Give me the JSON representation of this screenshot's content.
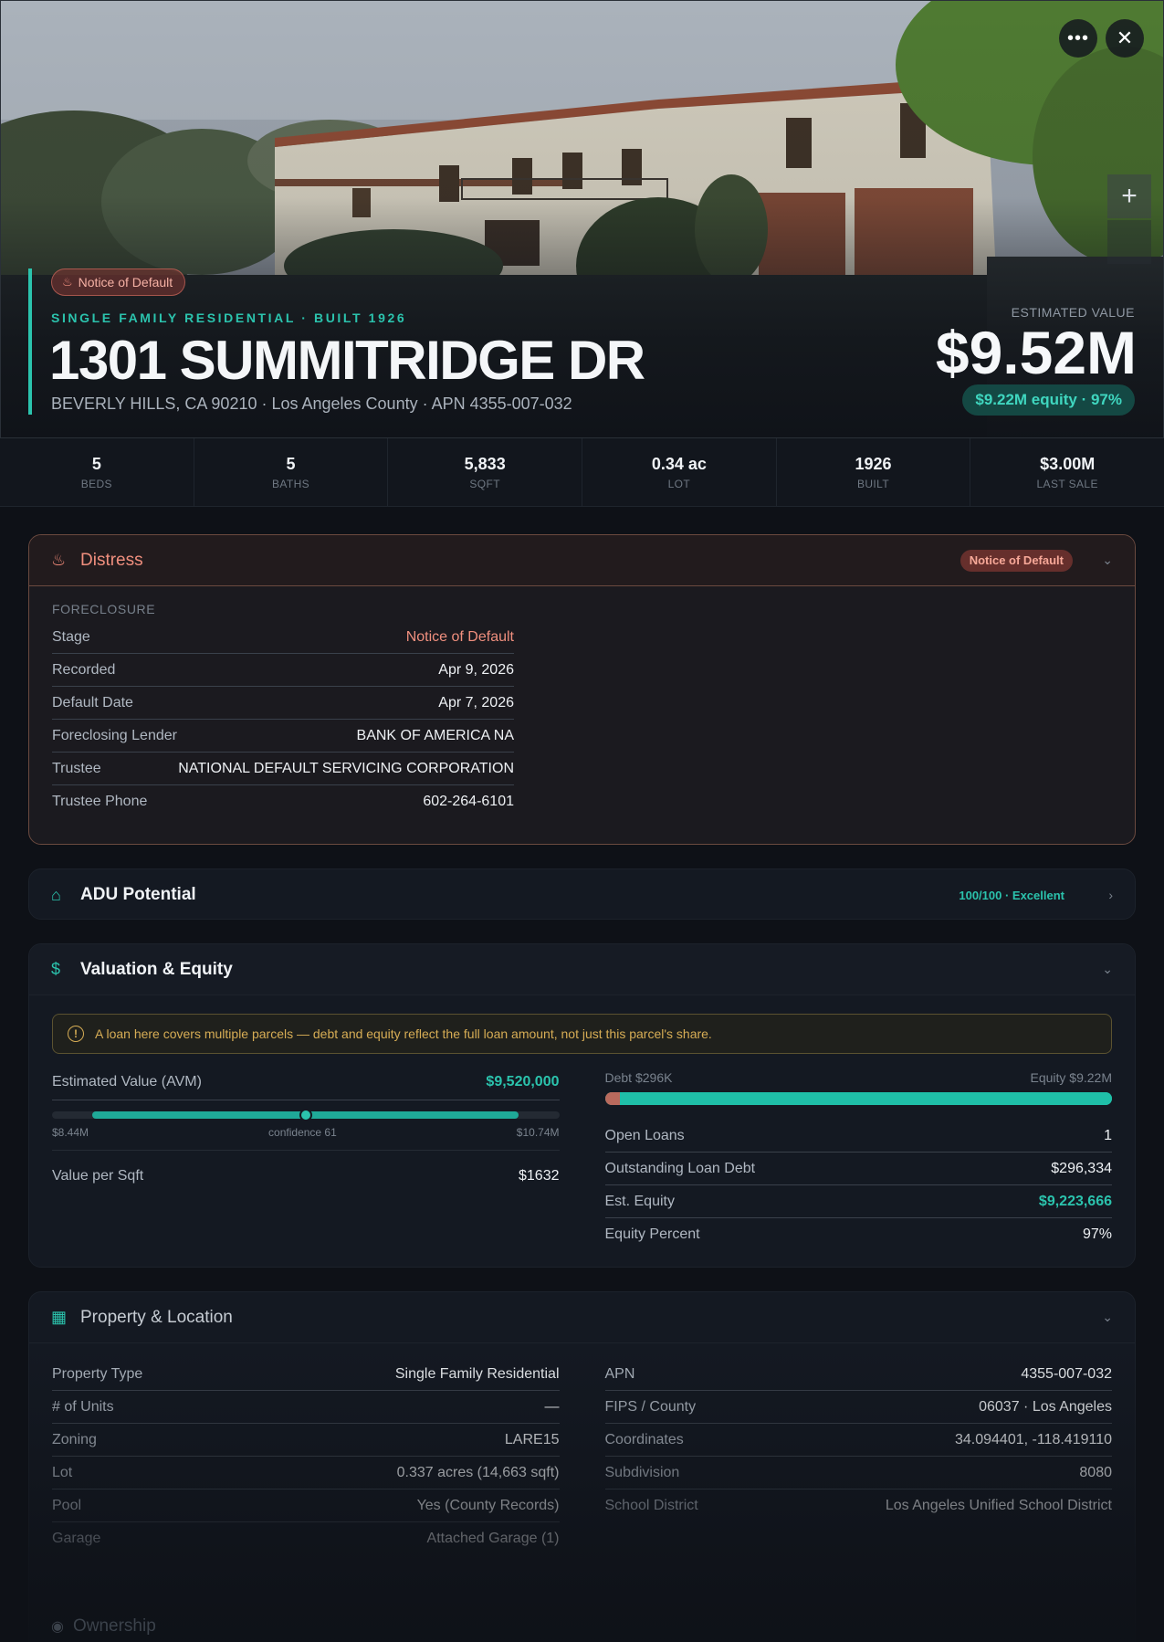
{
  "hero": {
    "badge": "Notice of Default",
    "subtitle": "SINGLE FAMILY RESIDENTIAL · BUILT 1926",
    "title": "1301 SUMMITRIDGE DR",
    "address": "BEVERLY HILLS, CA 90210 · Los Angeles County · APN 4355-007-032",
    "estimated_label": "ESTIMATED VALUE",
    "estimated_value": "$9.52M",
    "equity_pill": "$9.22M equity · 97%",
    "more_icon": "more-horizontal-icon",
    "close_icon": "close-icon",
    "zoom_icon": "plus-icon"
  },
  "stats": [
    {
      "value": "5",
      "label": "BEDS"
    },
    {
      "value": "5",
      "label": "BATHS"
    },
    {
      "value": "5,833",
      "label": "SQFT"
    },
    {
      "value": "0.34 ac",
      "label": "LOT"
    },
    {
      "value": "1926",
      "label": "BUILT"
    },
    {
      "value": "$3.00M",
      "label": "LAST SALE"
    }
  ],
  "distress": {
    "title": "Distress",
    "badge": "Notice of Default",
    "icon": "flame-icon",
    "section": "FORECLOSURE",
    "rows": [
      {
        "label": "Stage",
        "value": "Notice of Default"
      },
      {
        "label": "Recorded",
        "value": "Apr 9, 2026"
      },
      {
        "label": "Default Date",
        "value": "Apr 7, 2026"
      },
      {
        "label": "Foreclosing Lender",
        "value": "BANK OF AMERICA NA"
      },
      {
        "label": "Trustee",
        "value": "NATIONAL DEFAULT SERVICING CORPORATION"
      },
      {
        "label": "Trustee Phone",
        "value": "602-264-6101"
      }
    ]
  },
  "adu": {
    "title": "ADU Potential",
    "score": "100/100 · Excellent",
    "icon": "home-icon"
  },
  "valuation": {
    "title": "Valuation & Equity",
    "icon": "dollar-icon",
    "warning": "A loan here covers multiple parcels — debt and equity reflect the full loan amount, not just this parcel's share.",
    "avm_label": "Estimated Value (AVM)",
    "avm_value": "$9,520,000",
    "range_low": "$8.44M",
    "range_high": "$10.74M",
    "confidence": "confidence 61",
    "range_fill_start": 0.08,
    "range_fill_end": 0.92,
    "range_marker": 0.5,
    "vps_label": "Value per Sqft",
    "vps_value": "$1632",
    "debt_label": "Debt $296K",
    "equity_label": "Equity $9.22M",
    "debt_fraction": 0.03,
    "rows": [
      {
        "label": "Open Loans",
        "value": "1"
      },
      {
        "label": "Outstanding Loan Debt",
        "value": "$296,334"
      },
      {
        "label": "Est. Equity",
        "value": "$9,223,666"
      },
      {
        "label": "Equity Percent",
        "value": "97%"
      }
    ],
    "accent": "#2bc3ad"
  },
  "property": {
    "title": "Property & Location",
    "icon": "building-icon",
    "left": [
      {
        "label": "Property Type",
        "value": "Single Family Residential"
      },
      {
        "label": "# of Units",
        "value": "—"
      },
      {
        "label": "Zoning",
        "value": "LARE15"
      },
      {
        "label": "Lot",
        "value": "0.337 acres (14,663 sqft)"
      },
      {
        "label": "Pool",
        "value": "Yes (County Records)"
      },
      {
        "label": "Garage",
        "value": "Attached Garage (1)"
      }
    ],
    "right": [
      {
        "label": "APN",
        "value": "4355-007-032"
      },
      {
        "label": "FIPS / County",
        "value": "06037 · Los Angeles"
      },
      {
        "label": "Coordinates",
        "value": "34.094401, -118.419110"
      },
      {
        "label": "Subdivision",
        "value": "8080"
      },
      {
        "label": "School District",
        "value": "Los Angeles Unified School District"
      }
    ]
  },
  "ownership": {
    "title": "Ownership",
    "icon": "user-icon"
  },
  "colors": {
    "teal": "#2bc3ad",
    "distress": "#f08f7e",
    "warning": "#d7ad55",
    "background": "#0e1117"
  }
}
